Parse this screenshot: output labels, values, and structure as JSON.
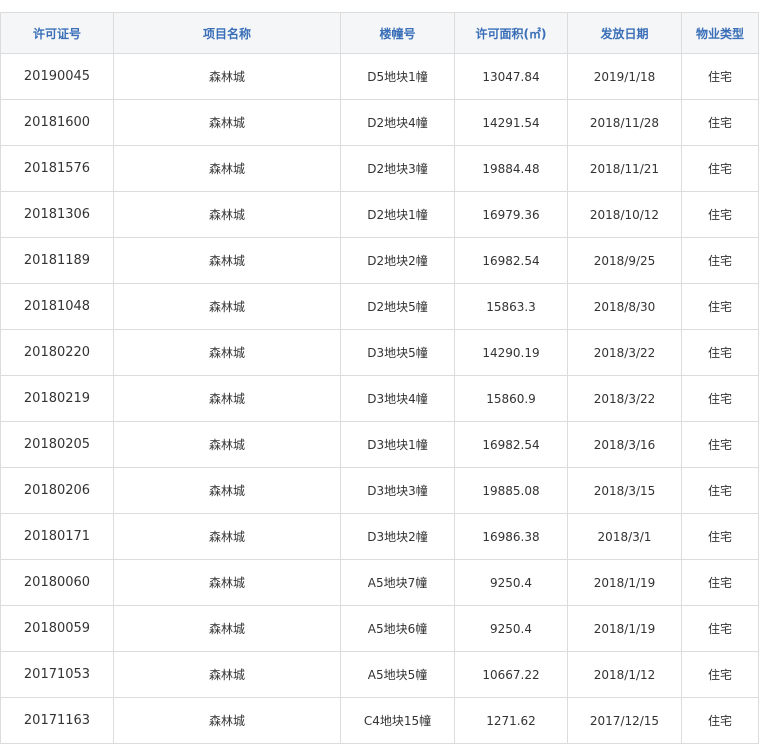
{
  "table": {
    "headers": [
      "许可证号",
      "项目名称",
      "楼幢号",
      "许可面积(㎡)",
      "发放日期",
      "物业类型"
    ],
    "rows": [
      [
        "20190045",
        "森林城",
        "D5地块1幢",
        "13047.84",
        "2019/1/18",
        "住宅"
      ],
      [
        "20181600",
        "森林城",
        "D2地块4幢",
        "14291.54",
        "2018/11/28",
        "住宅"
      ],
      [
        "20181576",
        "森林城",
        "D2地块3幢",
        "19884.48",
        "2018/11/21",
        "住宅"
      ],
      [
        "20181306",
        "森林城",
        "D2地块1幢",
        "16979.36",
        "2018/10/12",
        "住宅"
      ],
      [
        "20181189",
        "森林城",
        "D2地块2幢",
        "16982.54",
        "2018/9/25",
        "住宅"
      ],
      [
        "20181048",
        "森林城",
        "D2地块5幢",
        "15863.3",
        "2018/8/30",
        "住宅"
      ],
      [
        "20180220",
        "森林城",
        "D3地块5幢",
        "14290.19",
        "2018/3/22",
        "住宅"
      ],
      [
        "20180219",
        "森林城",
        "D3地块4幢",
        "15860.9",
        "2018/3/22",
        "住宅"
      ],
      [
        "20180205",
        "森林城",
        "D3地块1幢",
        "16982.54",
        "2018/3/16",
        "住宅"
      ],
      [
        "20180206",
        "森林城",
        "D3地块3幢",
        "19885.08",
        "2018/3/15",
        "住宅"
      ],
      [
        "20180171",
        "森林城",
        "D3地块2幢",
        "16986.38",
        "2018/3/1",
        "住宅"
      ],
      [
        "20180060",
        "森林城",
        "A5地块7幢",
        "9250.4",
        "2018/1/19",
        "住宅"
      ],
      [
        "20180059",
        "森林城",
        "A5地块6幢",
        "9250.4",
        "2018/1/19",
        "住宅"
      ],
      [
        "20171053",
        "森林城",
        "A5地块5幢",
        "10667.22",
        "2018/1/12",
        "住宅"
      ],
      [
        "20171163",
        "森林城",
        "C4地块15幢",
        "1271.62",
        "2017/12/15",
        "住宅"
      ]
    ]
  }
}
